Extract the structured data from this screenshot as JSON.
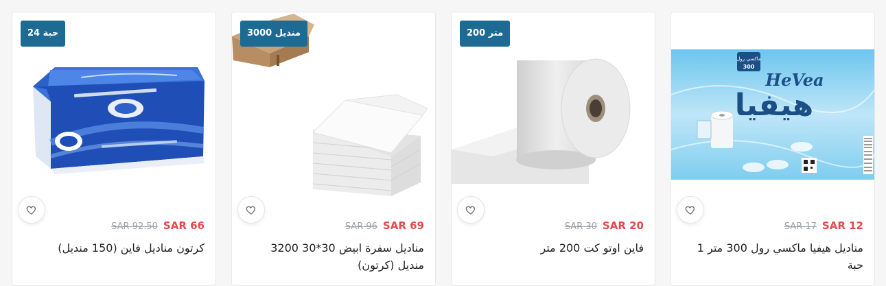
{
  "currency": "SAR",
  "products": [
    {
      "badge": "24 حبة",
      "price": "66",
      "old_price": "92.50",
      "title": "كرتون مناديل فاين (150 منديل)"
    },
    {
      "badge": "3000 منديل",
      "price": "69",
      "old_price": "96",
      "title": "مناديل سفرة ابيض 30*30 3200 منديل (كرتون)"
    },
    {
      "badge": "200 متر",
      "price": "20",
      "old_price": "30",
      "title": "فاين اوتو كت 200 متر"
    },
    {
      "price": "12",
      "old_price": "17",
      "title": "مناديل هيفيا ماكسي رول 300 متر 1 حبة",
      "image_text": {
        "brand_latin": "HeVea",
        "brand_arabic": "هيفيا",
        "pack_arabic": "ماكسي رول",
        "pack_size": "300"
      }
    }
  ],
  "colors": {
    "badge": "#1d6b93",
    "price": "#e5484d",
    "old_price": "#9aa0a6"
  },
  "icons": {
    "wishlist": "heart-outline-icon"
  }
}
